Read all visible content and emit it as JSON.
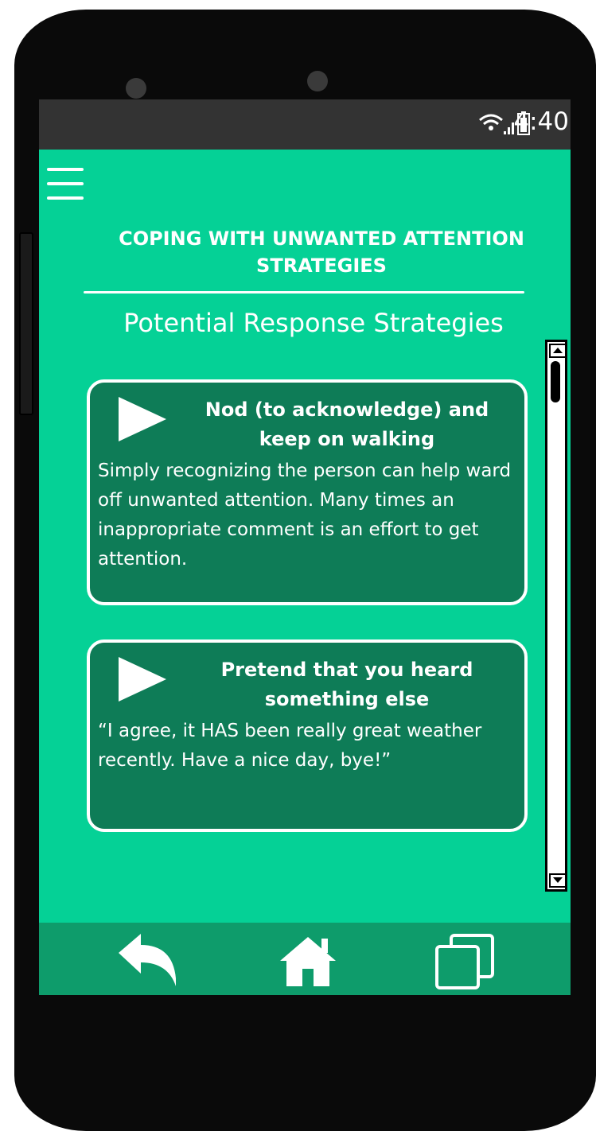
{
  "status_bar": {
    "icons": "὏6",
    "time": "4:40"
  },
  "header": {
    "menu_icon": "hamburger-menu-icon",
    "title": "COPING WITH UNWANTED ATTENTION STRATEGIES",
    "subtitle": "Potential Response Strategies"
  },
  "strategies": [
    {
      "icon": "play-icon",
      "title": "Nod (to acknowledge) and keep on walking",
      "body": "Simply recognizing the person can help ward off unwanted attention. Many times an inappropriate comment is an effort to get attention."
    },
    {
      "icon": "play-icon",
      "title": "Pretend that you heard something else",
      "body": "“I agree, it HAS been really great weather recently. Have a nice day, bye!”"
    }
  ],
  "nav": {
    "back_icon": "back-arrow-icon",
    "home_icon": "home-icon",
    "recent_icon": "recent-apps-icon"
  },
  "colors": {
    "screen_bg": "#05d196",
    "card_bg": "#0e7c57",
    "nav_bg": "#0e9c6b",
    "status_bg": "#333333"
  }
}
